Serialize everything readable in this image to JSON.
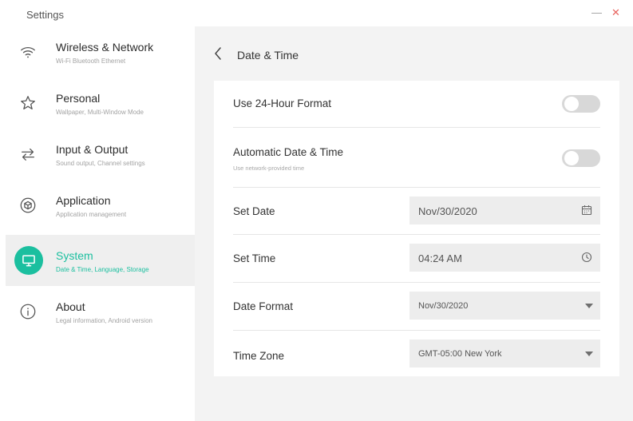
{
  "window": {
    "title": "Settings",
    "minimize_glyph": "—",
    "close_glyph": "✕",
    "close_color": "#e8645f"
  },
  "sidebar": {
    "items": [
      {
        "label": "Wireless & Network",
        "sub": "Wi-Fi Bluetooth Ethernet",
        "icon": "wifi-icon"
      },
      {
        "label": "Personal",
        "sub": "Wallpaper, Multi-Window Mode",
        "icon": "star-icon"
      },
      {
        "label": "Input & Output",
        "sub": "Sound output, Channel settings",
        "icon": "arrows-icon"
      },
      {
        "label": "Application",
        "sub": "Application management",
        "icon": "cube-icon"
      },
      {
        "label": "System",
        "sub": "Date & Time, Language, Storage",
        "icon": "monitor-icon",
        "active": true
      },
      {
        "label": "About",
        "sub": "Legal information, Android version",
        "icon": "info-icon"
      }
    ],
    "accent_color": "#1bbf9f"
  },
  "page": {
    "title": "Date & Time",
    "rows": {
      "format24": {
        "label": "Use 24-Hour Format",
        "toggle_on": false
      },
      "auto": {
        "label": "Automatic Date & Time",
        "sub": "Use network-provided time",
        "toggle_on": false
      },
      "set_date": {
        "label": "Set Date",
        "value": "Nov/30/2020",
        "icon": "calendar-icon"
      },
      "set_time": {
        "label": "Set Time",
        "value": "04:24 AM",
        "icon": "clock-icon"
      },
      "date_format": {
        "label": "Date Format",
        "value": "Nov/30/2020",
        "icon": "caret-down-icon"
      },
      "time_zone": {
        "label": "Time Zone",
        "value": "GMT-05:00 New York",
        "icon": "caret-down-icon"
      }
    }
  }
}
